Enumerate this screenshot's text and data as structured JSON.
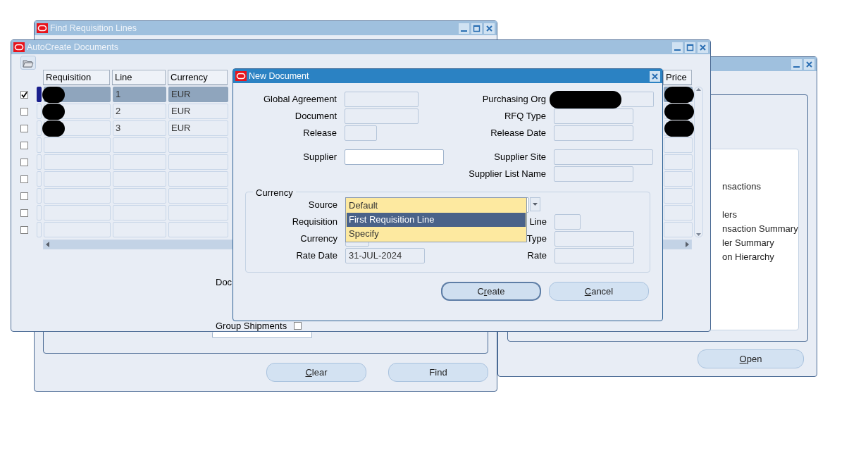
{
  "right_window": {
    "active": false,
    "title_buttons": [
      {
        "kind": "minimize"
      },
      {
        "kind": "close"
      }
    ],
    "list_items": [
      "nsactions",
      "lers",
      "nsaction Summary",
      "ler Summary",
      "on Hierarchy"
    ],
    "button": {
      "mnemonic": "O",
      "text_after": "pen"
    }
  },
  "find_window": {
    "title": "Find Requisition Lines",
    "active": false,
    "title_buttons": [
      {
        "kind": "minimize"
      },
      {
        "kind": "maximize"
      },
      {
        "kind": "close"
      }
    ],
    "buttons": [
      {
        "mnemonic": "C",
        "text_after": "lear"
      },
      {
        "text_after": "Find"
      }
    ]
  },
  "autocreate_window": {
    "title": "AutoCreate Documents",
    "active": false,
    "title_buttons": [
      {
        "kind": "minimize"
      },
      {
        "kind": "maximize"
      },
      {
        "kind": "close"
      }
    ],
    "columns": [
      "Requisition",
      "Line",
      "Currency",
      "Price"
    ],
    "rows": [
      {
        "checked": true,
        "selected": true,
        "requisition_redacted": true,
        "line": "1",
        "currency": "EUR",
        "price_redacted": true
      },
      {
        "checked": false,
        "selected": false,
        "requisition_redacted": true,
        "line": "2",
        "currency": "EUR",
        "price_redacted": true
      },
      {
        "checked": false,
        "selected": false,
        "requisition_redacted": true,
        "line": "3",
        "currency": "EUR",
        "price_redacted": true
      },
      {
        "checked": false,
        "selected": false
      },
      {
        "checked": false,
        "selected": false
      },
      {
        "checked": false,
        "selected": false
      },
      {
        "checked": false,
        "selected": false
      },
      {
        "checked": false,
        "selected": false
      },
      {
        "checked": false,
        "selected": false
      }
    ],
    "document_label": "Doc",
    "group_shipments": {
      "label": "Group Shipments",
      "checked": false
    }
  },
  "new_document": {
    "title": "New Document",
    "active": true,
    "title_buttons": [
      {
        "kind": "close"
      }
    ],
    "rows": [
      {
        "left": {
          "label": "Global Agreement",
          "editable": false
        },
        "right": {
          "label": "Purchasing Org",
          "editable": false,
          "redacted": true
        }
      },
      {
        "left": {
          "label": "Document",
          "editable": false
        },
        "right": {
          "label": "RFQ Type",
          "editable": false
        }
      },
      {
        "left": {
          "label": "Release",
          "editable": false
        },
        "right": {
          "label": "Release Date",
          "editable": false
        }
      },
      {
        "left": {
          "label": "Supplier",
          "editable": true
        },
        "right": {
          "label": "Supplier Site",
          "editable": false
        }
      },
      {
        "right": {
          "label": "Supplier List Name",
          "editable": false
        }
      }
    ],
    "currency_group": {
      "legend": "Currency",
      "source": {
        "label": "Source",
        "expanded": true,
        "options": [
          {
            "label": "Default",
            "selected": false
          },
          {
            "label": "First Requisition Line",
            "selected": true
          },
          {
            "label": "Specify",
            "selected": false
          }
        ]
      },
      "rows": [
        {
          "left": {
            "label": "Requisition"
          },
          "right": {
            "label": "Line",
            "editable": false
          }
        },
        {
          "left": {
            "label": "Currency",
            "editable": false
          },
          "right": {
            "label": "Type",
            "editable": false
          }
        },
        {
          "left": {
            "label": "Rate Date",
            "editable": false,
            "value": "31-JUL-2024"
          },
          "right": {
            "label": "Rate",
            "editable": false
          }
        }
      ]
    },
    "buttons": [
      {
        "text_before": "C",
        "mnemonic": "r",
        "text_after": "eate",
        "default": true
      },
      {
        "mnemonic": "C",
        "text_after": "ancel",
        "default": false
      }
    ]
  }
}
